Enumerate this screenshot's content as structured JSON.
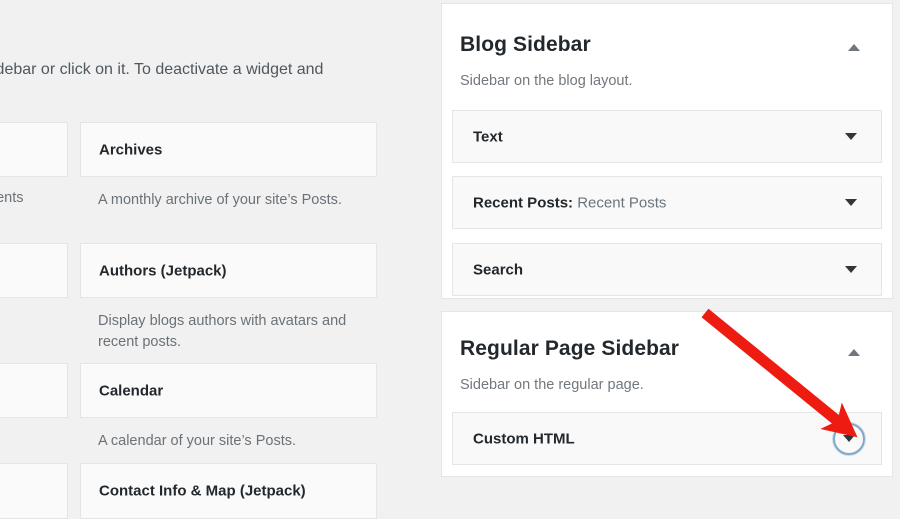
{
  "colors": {
    "page_bg": "#f1f1f1",
    "panel_bg": "#ffffff",
    "row_bg": "#f9f9f9",
    "border": "#e5e5e5",
    "heading": "#23282d",
    "muted_text": "#6a7278",
    "arrow_red": "#ee1c10",
    "focus_ring": "#80a8c8"
  },
  "available_widgets": {
    "intro_text": "idebar or click on it. To deactivate a widget and",
    "clipped_left_text": "ments",
    "items": [
      {
        "title": "Archives",
        "description": "A monthly archive of your site’s Posts."
      },
      {
        "title": "Authors (Jetpack)",
        "description": "Display blogs authors with avatars and recent posts."
      },
      {
        "title": "Calendar",
        "description": "A calendar of your site’s Posts."
      },
      {
        "title": "Contact Info & Map (Jetpack)",
        "description": ""
      }
    ]
  },
  "sidebars": [
    {
      "title": "Blog Sidebar",
      "description": "Sidebar on the blog layout.",
      "collapse_icon": "triangle-up-icon",
      "widgets": [
        {
          "name": "Text",
          "instance": "",
          "toggle_icon": "triangle-down-icon",
          "focused": false
        },
        {
          "name": "Recent Posts:",
          "instance": "Recent Posts",
          "toggle_icon": "triangle-down-icon",
          "focused": false
        },
        {
          "name": "Search",
          "instance": "",
          "toggle_icon": "triangle-down-icon",
          "focused": false
        }
      ]
    },
    {
      "title": "Regular Page Sidebar",
      "description": "Sidebar on the regular page.",
      "collapse_icon": "triangle-up-icon",
      "widgets": [
        {
          "name": "Custom HTML",
          "instance": "",
          "toggle_icon": "triangle-down-icon",
          "focused": true
        }
      ]
    }
  ],
  "annotation": {
    "type": "arrow",
    "color": "#ee1c10",
    "points_to": "custom-html-expand-toggle"
  }
}
